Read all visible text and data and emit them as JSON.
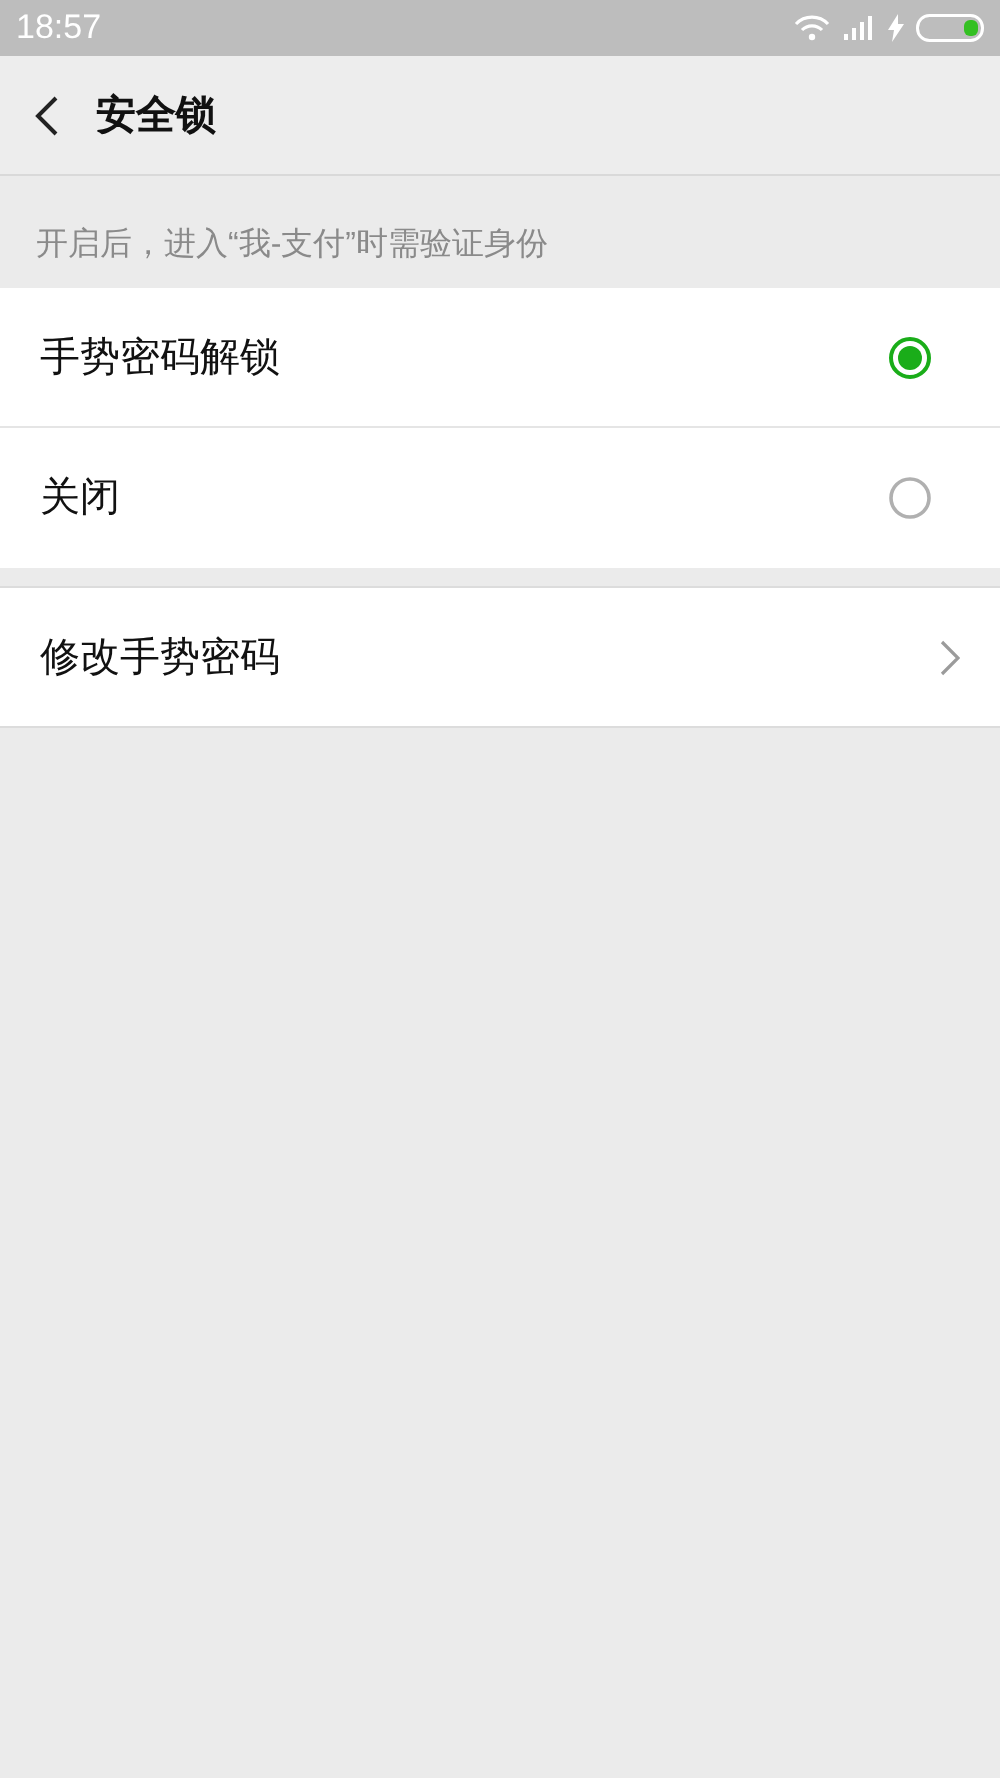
{
  "status_bar": {
    "time": "18:57"
  },
  "header": {
    "title": "安全锁"
  },
  "hint": "开启后，进入“我-支付”时需验证身份",
  "options": [
    {
      "label": "手势密码解锁",
      "selected": true
    },
    {
      "label": "关闭",
      "selected": false
    }
  ],
  "links": [
    {
      "label": "修改手势密码"
    }
  ]
}
